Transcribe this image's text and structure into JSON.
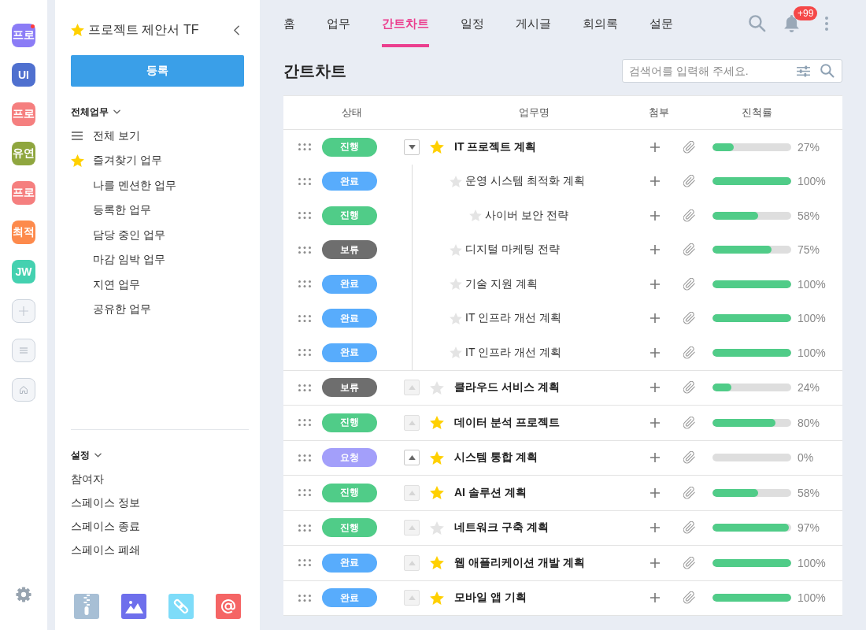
{
  "rail": {
    "spaces": [
      {
        "label": "프로",
        "color": "#8b7cf6",
        "unread": true
      },
      {
        "label": "UI",
        "color": "#4f70cf",
        "unread": false
      },
      {
        "label": "프로",
        "color": "#f57f7f",
        "unread": false
      },
      {
        "label": "유연",
        "color": "#8fa63f",
        "unread": false
      },
      {
        "label": "프로",
        "color": "#f57f7f",
        "unread": false
      },
      {
        "label": "최적",
        "color": "#fd8a4c",
        "unread": false
      },
      {
        "label": "JW",
        "color": "#44d1b0",
        "unread": false
      }
    ]
  },
  "sidebar": {
    "title": "프로젝트 제안서 TF",
    "favorite": true,
    "register_button": "등록",
    "sections": [
      {
        "title": "전체업무",
        "expanded": true,
        "items": [
          {
            "label": "전체 보기",
            "kind": "all"
          },
          {
            "label": "즐겨찾기 업무",
            "kind": "favorites"
          },
          {
            "label": "나를 멘션한 업무",
            "kind": "filter"
          },
          {
            "label": "등록한 업무",
            "kind": "filter"
          },
          {
            "label": "담당 중인 업무",
            "kind": "filter"
          },
          {
            "label": "마감 임박 업무",
            "kind": "filter"
          },
          {
            "label": "지연 업무",
            "kind": "filter"
          },
          {
            "label": "공유한 업무",
            "kind": "filter"
          }
        ]
      },
      {
        "title": "설정",
        "expanded": true,
        "items": [
          {
            "label": "참여자",
            "kind": "setting"
          },
          {
            "label": "스페이스 정보",
            "kind": "setting"
          },
          {
            "label": "스페이스 종료",
            "kind": "setting"
          },
          {
            "label": "스페이스 폐쇄",
            "kind": "setting"
          }
        ]
      }
    ]
  },
  "tabs": [
    {
      "label": "홈",
      "selected": false
    },
    {
      "label": "업무",
      "selected": false
    },
    {
      "label": "간트차트",
      "selected": true
    },
    {
      "label": "일정",
      "selected": false
    },
    {
      "label": "게시글",
      "selected": false
    },
    {
      "label": "회의록",
      "selected": false
    },
    {
      "label": "설문",
      "selected": false
    }
  ],
  "notifications": {
    "badge": "+99"
  },
  "page_title": "간트차트",
  "search": {
    "placeholder": "검색어를 입력해 주세요."
  },
  "table": {
    "columns": [
      "상태",
      "업무명",
      "첨부",
      "진척률"
    ],
    "rows": [
      {
        "status": "진행",
        "color": "#50cc88",
        "name": "IT 프로젝트 계획",
        "favorite": true,
        "expanded": true,
        "toggle_disabled": false,
        "level": 0.27,
        "progress": "27%",
        "children": [
          {
            "status": "완료",
            "color": "#58acfc",
            "name": "운영 시스템 최적화 계획",
            "favorite": false,
            "level": 1,
            "progress": "100%",
            "children": [
              {
                "status": "진행",
                "color": "#50cc88",
                "name": "사이버 보안 전략",
                "favorite": false,
                "level": 0.58,
                "progress": "58%"
              }
            ]
          },
          {
            "status": "보류",
            "color": "#6e6e6e",
            "name": "디지털 마케팅 전략",
            "favorite": false,
            "level": 0.75,
            "progress": "75%"
          },
          {
            "status": "완료",
            "color": "#58acfc",
            "name": "기술 지원 계획",
            "favorite": false,
            "level": 1,
            "progress": "100%"
          },
          {
            "status": "완료",
            "color": "#58acfc",
            "name": "IT 인프라 개선 계획",
            "favorite": false,
            "level": 1,
            "progress": "100%"
          },
          {
            "status": "완료",
            "color": "#58acfc",
            "name": "IT 인프라 개선 계획",
            "favorite": false,
            "level": 1,
            "progress": "100%"
          }
        ]
      },
      {
        "status": "보류",
        "color": "#6e6e6e",
        "name": "클라우드 서비스 계획",
        "favorite": false,
        "expanded": false,
        "toggle_disabled": true,
        "level": 0.24,
        "progress": "24%"
      },
      {
        "status": "진행",
        "color": "#50cc88",
        "name": "데이터 분석 프로젝트",
        "favorite": true,
        "expanded": false,
        "toggle_disabled": true,
        "level": 0.8,
        "progress": "80%"
      },
      {
        "status": "요청",
        "color": "#a39ffa",
        "name": "시스템 통합 계획",
        "favorite": true,
        "expanded": false,
        "toggle_disabled": false,
        "level": 0,
        "progress": "0%"
      },
      {
        "status": "진행",
        "color": "#50cc88",
        "name": "AI 솔루션 계획",
        "favorite": true,
        "expanded": false,
        "toggle_disabled": true,
        "level": 0.58,
        "progress": "58%"
      },
      {
        "status": "진행",
        "color": "#50cc88",
        "name": "네트워크 구축 계획",
        "favorite": false,
        "expanded": false,
        "toggle_disabled": true,
        "level": 0.97,
        "progress": "97%"
      },
      {
        "status": "완료",
        "color": "#58acfc",
        "name": "웹 애플리케이션 개발 계획",
        "favorite": true,
        "expanded": false,
        "toggle_disabled": true,
        "level": 1,
        "progress": "100%"
      },
      {
        "status": "완료",
        "color": "#58acfc",
        "name": "모바일 앱 기획",
        "favorite": true,
        "expanded": false,
        "toggle_disabled": true,
        "level": 1,
        "progress": "100%"
      }
    ]
  }
}
